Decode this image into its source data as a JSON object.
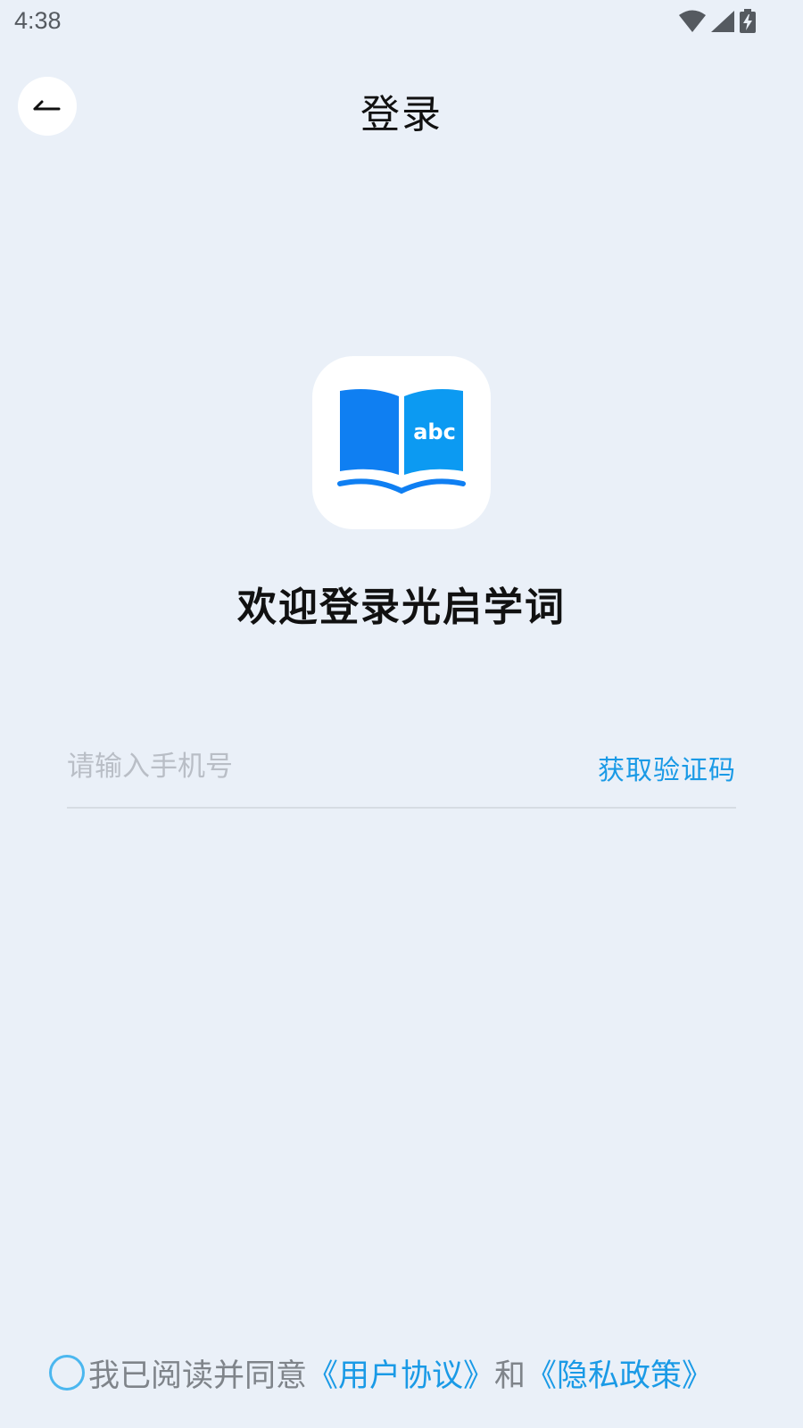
{
  "status_bar": {
    "time": "4:38"
  },
  "header": {
    "back_icon": "back-arrow-icon",
    "title": "登录"
  },
  "logo": {
    "icon": "open-book-abc-icon",
    "text": "abc",
    "colors": {
      "left_page": "#0f7ff2",
      "right_page": "#0c9af2"
    }
  },
  "welcome": {
    "title": "欢迎登录光启学词"
  },
  "login_form": {
    "phone_placeholder": "请输入手机号",
    "phone_value": "",
    "get_code_label": "获取验证码"
  },
  "agreement": {
    "checked": false,
    "prefix": "我已阅读并同意",
    "user_agreement": "《用户协议》",
    "and": "和",
    "privacy_policy": "《隐私政策》"
  },
  "colors": {
    "background": "#eaf0f8",
    "accent": "#1a9ae6",
    "checkbox": "#4bb7ef"
  }
}
